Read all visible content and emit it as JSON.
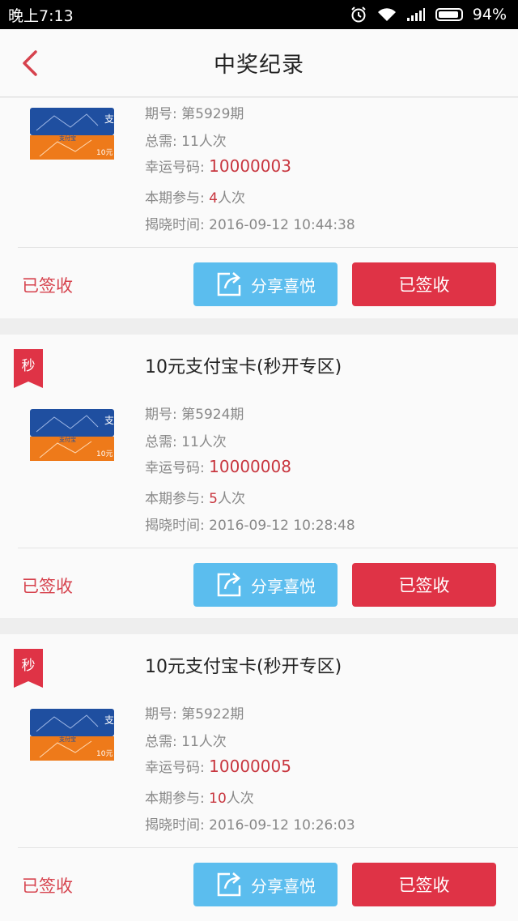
{
  "status_bar": {
    "time": "晚上7:13",
    "battery": "94%",
    "battery_level": 0.94,
    "icons": [
      "alarm-icon",
      "wifi-icon",
      "signal-icon",
      "battery-icon"
    ]
  },
  "header": {
    "title": "中奖纪录",
    "back_icon": "chevron-left-icon"
  },
  "labels": {
    "period": "期号: ",
    "total": "总需: ",
    "lucky": "幸运号码: ",
    "joined": "本期参与: ",
    "reveal": "揭晓时间: ",
    "share": "分享喜悦",
    "signed": "已签收",
    "status": "已签收",
    "badge": "秒"
  },
  "records": [
    {
      "title": "",
      "period": "第5929期",
      "total": "11人次",
      "lucky_number": "10000003",
      "joined_count": "4",
      "joined_unit": "人次",
      "reveal_time": "2016-09-12 10:44:38"
    },
    {
      "title": "10元支付宝卡(秒开专区)",
      "period": "第5924期",
      "total": "11人次",
      "lucky_number": "10000008",
      "joined_count": "5",
      "joined_unit": "人次",
      "reveal_time": "2016-09-12 10:28:48"
    },
    {
      "title": "10元支付宝卡(秒开专区)",
      "period": "第5922期",
      "total": "11人次",
      "lucky_number": "10000005",
      "joined_count": "10",
      "joined_unit": "人次",
      "reveal_time": "2016-09-12 10:26:03"
    }
  ],
  "card_image": {
    "brand_text": "支付宝",
    "value_text": "10元",
    "logo_glyph": "支"
  },
  "colors": {
    "accent_red": "#df3346",
    "share_blue": "#5bbdee",
    "highlight_red": "#c8363f",
    "card_blue": "#1f4fa0",
    "card_orange": "#ee7a1a"
  }
}
